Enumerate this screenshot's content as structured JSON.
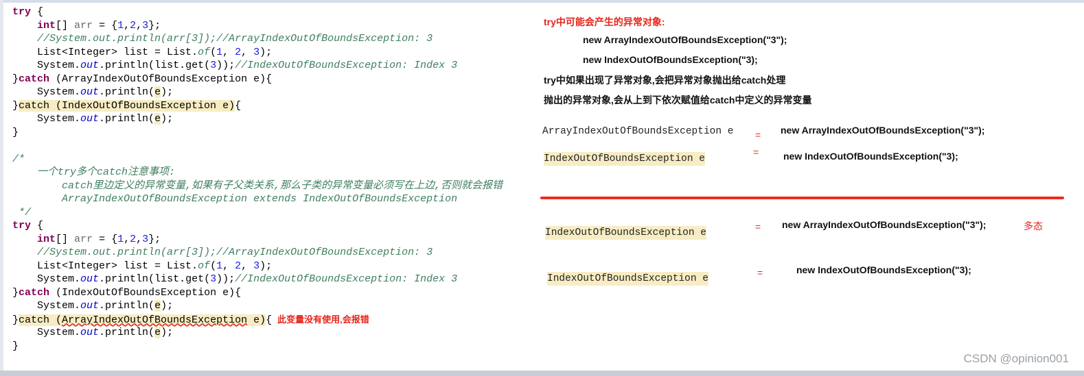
{
  "code_lines": [
    [
      {
        "t": "try",
        "c": "kw"
      },
      {
        "t": " {"
      }
    ],
    [
      {
        "t": "    "
      },
      {
        "t": "int",
        "c": "kw"
      },
      {
        "t": "[] "
      },
      {
        "t": "arr",
        "c": "var"
      },
      {
        "t": " = {"
      },
      {
        "t": "1",
        "c": "num"
      },
      {
        "t": ","
      },
      {
        "t": "2",
        "c": "num"
      },
      {
        "t": ","
      },
      {
        "t": "3",
        "c": "num"
      },
      {
        "t": "};"
      }
    ],
    [
      {
        "t": "    "
      },
      {
        "t": "//System.out.println(arr[3]);//ArrayIndexOutOfBoundsException: 3",
        "c": "cm"
      }
    ],
    [
      {
        "t": "    List<Integer> list = List."
      },
      {
        "t": "of",
        "c": "cm"
      },
      {
        "t": "("
      },
      {
        "t": "1",
        "c": "num"
      },
      {
        "t": ", "
      },
      {
        "t": "2",
        "c": "num"
      },
      {
        "t": ", "
      },
      {
        "t": "3",
        "c": "num"
      },
      {
        "t": ");"
      }
    ],
    [
      {
        "t": "    System."
      },
      {
        "t": "out",
        "c": "fld"
      },
      {
        "t": ".println(list.get("
      },
      {
        "t": "3",
        "c": "num"
      },
      {
        "t": "));"
      },
      {
        "t": "//IndexOutOfBoundsException: Index 3",
        "c": "cm"
      }
    ],
    [
      {
        "t": "}"
      },
      {
        "t": "catch",
        "c": "kw"
      },
      {
        "t": " (ArrayIndexOutOfBoundsException e){"
      }
    ],
    [
      {
        "t": "    System."
      },
      {
        "t": "out",
        "c": "fld"
      },
      {
        "t": ".println("
      },
      {
        "t": "e",
        "c": "hl"
      },
      {
        "t": ");"
      }
    ],
    [
      {
        "t": "}"
      },
      {
        "t": "catch (IndexOutOfBoundsException e)",
        "c": "hl kwpart"
      },
      {
        "t": "{"
      }
    ],
    [
      {
        "t": "    System."
      },
      {
        "t": "out",
        "c": "fld"
      },
      {
        "t": ".println("
      },
      {
        "t": "e",
        "c": "hl"
      },
      {
        "t": ");"
      }
    ],
    [
      {
        "t": "}"
      }
    ],
    [
      {
        "t": ""
      }
    ],
    [
      {
        "t": "/*",
        "c": "cm"
      }
    ],
    [
      {
        "t": "    一个try多个catch注意事项:",
        "c": "cm"
      }
    ],
    [
      {
        "t": "        catch里边定义的异常变量,如果有子父类关系,那么子类的异常变量必须写在上边,否则就会报错",
        "c": "cm"
      }
    ],
    [
      {
        "t": "        ArrayIndexOutOfBoundsException extends IndexOutOfBoundsException",
        "c": "cm"
      }
    ],
    [
      {
        "t": " */",
        "c": "cm"
      }
    ],
    [
      {
        "t": "try",
        "c": "kw"
      },
      {
        "t": " {"
      }
    ],
    [
      {
        "t": "    "
      },
      {
        "t": "int",
        "c": "kw"
      },
      {
        "t": "[] "
      },
      {
        "t": "arr",
        "c": "var"
      },
      {
        "t": " = {"
      },
      {
        "t": "1",
        "c": "num"
      },
      {
        "t": ","
      },
      {
        "t": "2",
        "c": "num"
      },
      {
        "t": ","
      },
      {
        "t": "3",
        "c": "num"
      },
      {
        "t": "};"
      }
    ],
    [
      {
        "t": "    "
      },
      {
        "t": "//System.out.println(arr[3]);//ArrayIndexOutOfBoundsException: 3",
        "c": "cm"
      }
    ],
    [
      {
        "t": "    List<Integer> list = List."
      },
      {
        "t": "of",
        "c": "cm"
      },
      {
        "t": "("
      },
      {
        "t": "1",
        "c": "num"
      },
      {
        "t": ", "
      },
      {
        "t": "2",
        "c": "num"
      },
      {
        "t": ", "
      },
      {
        "t": "3",
        "c": "num"
      },
      {
        "t": ");"
      }
    ],
    [
      {
        "t": "    System."
      },
      {
        "t": "out",
        "c": "fld"
      },
      {
        "t": ".println(list.get("
      },
      {
        "t": "3",
        "c": "num"
      },
      {
        "t": "));"
      },
      {
        "t": "//IndexOutOfBoundsException: Index 3",
        "c": "cm"
      }
    ],
    [
      {
        "t": "}"
      },
      {
        "t": "catch",
        "c": "kw"
      },
      {
        "t": " (IndexOutOfBoundsException e){"
      }
    ],
    [
      {
        "t": "    System."
      },
      {
        "t": "out",
        "c": "fld"
      },
      {
        "t": ".println("
      },
      {
        "t": "e",
        "c": "hl"
      },
      {
        "t": ");"
      }
    ],
    [
      {
        "t": "}"
      },
      {
        "t": "catch (",
        "c": "hl"
      },
      {
        "t": "ArrayIndexOutOfBoundsException",
        "c": "hl err"
      },
      {
        "t": " e)",
        "c": "hl"
      },
      {
        "t": "{"
      },
      {
        "t": "此变量没有使用,会报错",
        "c": "note"
      }
    ],
    [
      {
        "t": "    System."
      },
      {
        "t": "out",
        "c": "fld"
      },
      {
        "t": ".println("
      },
      {
        "t": "e",
        "c": "hl"
      },
      {
        "t": ");"
      }
    ],
    [
      {
        "t": "}"
      }
    ]
  ],
  "notes": {
    "heading": "try中可能会产生的异常对象:",
    "obj1": "new ArrayIndexOutOfBoundsException(\"3\");",
    "obj2": "new IndexOutOfBoundsException(\"3);",
    "line3": "try中如果出现了异常对象,会把异常对象抛出给catch处理",
    "line4": "抛出的异常对象,会从上到下依次赋值给catch中定义的异常变量",
    "a1_var": "ArrayIndexOutOfBoundsException e",
    "a1_val": "new ArrayIndexOutOfBoundsException(\"3\");",
    "a2_var": "IndexOutOfBoundsException e",
    "a2_val": "new IndexOutOfBoundsException(\"3);",
    "b1_var": "IndexOutOfBoundsException e",
    "b1_val": "new ArrayIndexOutOfBoundsException(\"3\");",
    "b1_note": "多态",
    "b2_var": "IndexOutOfBoundsException e",
    "b2_val": "new IndexOutOfBoundsException(\"3);",
    "eq": "="
  },
  "watermark": "CSDN @opinion001",
  "colors": {
    "keyword": "#7f0055",
    "comment": "#3f7f5f",
    "number": "#1a1ae6",
    "highlight": "#f7ecc3",
    "accent_red": "#e8231a"
  }
}
